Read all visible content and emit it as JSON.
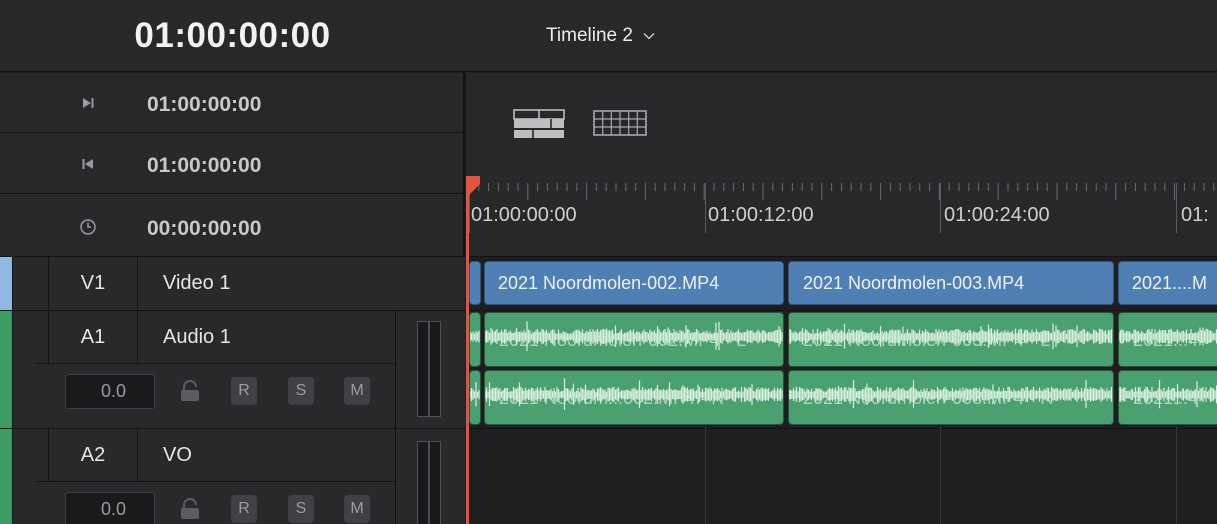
{
  "header": {
    "main_timecode": "01:00:00:00",
    "timeline_name": "Timeline 2"
  },
  "timecodes": [
    {
      "icon": "jump-to-end-icon",
      "value": "01:00:00:00"
    },
    {
      "icon": "jump-to-start-icon",
      "value": "01:00:00:00"
    },
    {
      "icon": "clock-icon",
      "value": "00:00:00:00"
    }
  ],
  "tracks": [
    {
      "id": "V1",
      "name": "Video 1",
      "color": "#8fb8e3"
    },
    {
      "id": "A1",
      "name": "Audio 1",
      "volume": "0.0",
      "r": "R",
      "s": "S",
      "m": "M",
      "color": "#3e9a63"
    },
    {
      "id": "A2",
      "name": "VO",
      "volume": "0.0",
      "r": "R",
      "s": "S",
      "m": "M",
      "color": "#3e9a63"
    }
  ],
  "view_icons": [
    "timeline-view-icon",
    "grid-view-icon"
  ],
  "ruler": {
    "labels": [
      "01:00:00:00",
      "01:00:12:00",
      "01:00:24:00",
      "01:"
    ]
  },
  "clips": {
    "video": [
      "2021 Noordmolen-002.MP4",
      "2021 Noordmolen-003.MP4",
      "2021....M"
    ],
    "audio_a1": [
      "2021 Noordmolen-002.MP4 - L",
      "2021 Noordmolen-003.MP4 - L",
      "2021...4"
    ],
    "audio_a2": [
      "2021 Noordm...002.MP4 - R",
      "2021 Noordmolen-003.MP4 - R",
      "2021...4"
    ]
  },
  "colors": {
    "video_clip": "#4f7fb3",
    "audio_clip": "#4aa06e",
    "playhead": "#e5523d"
  }
}
